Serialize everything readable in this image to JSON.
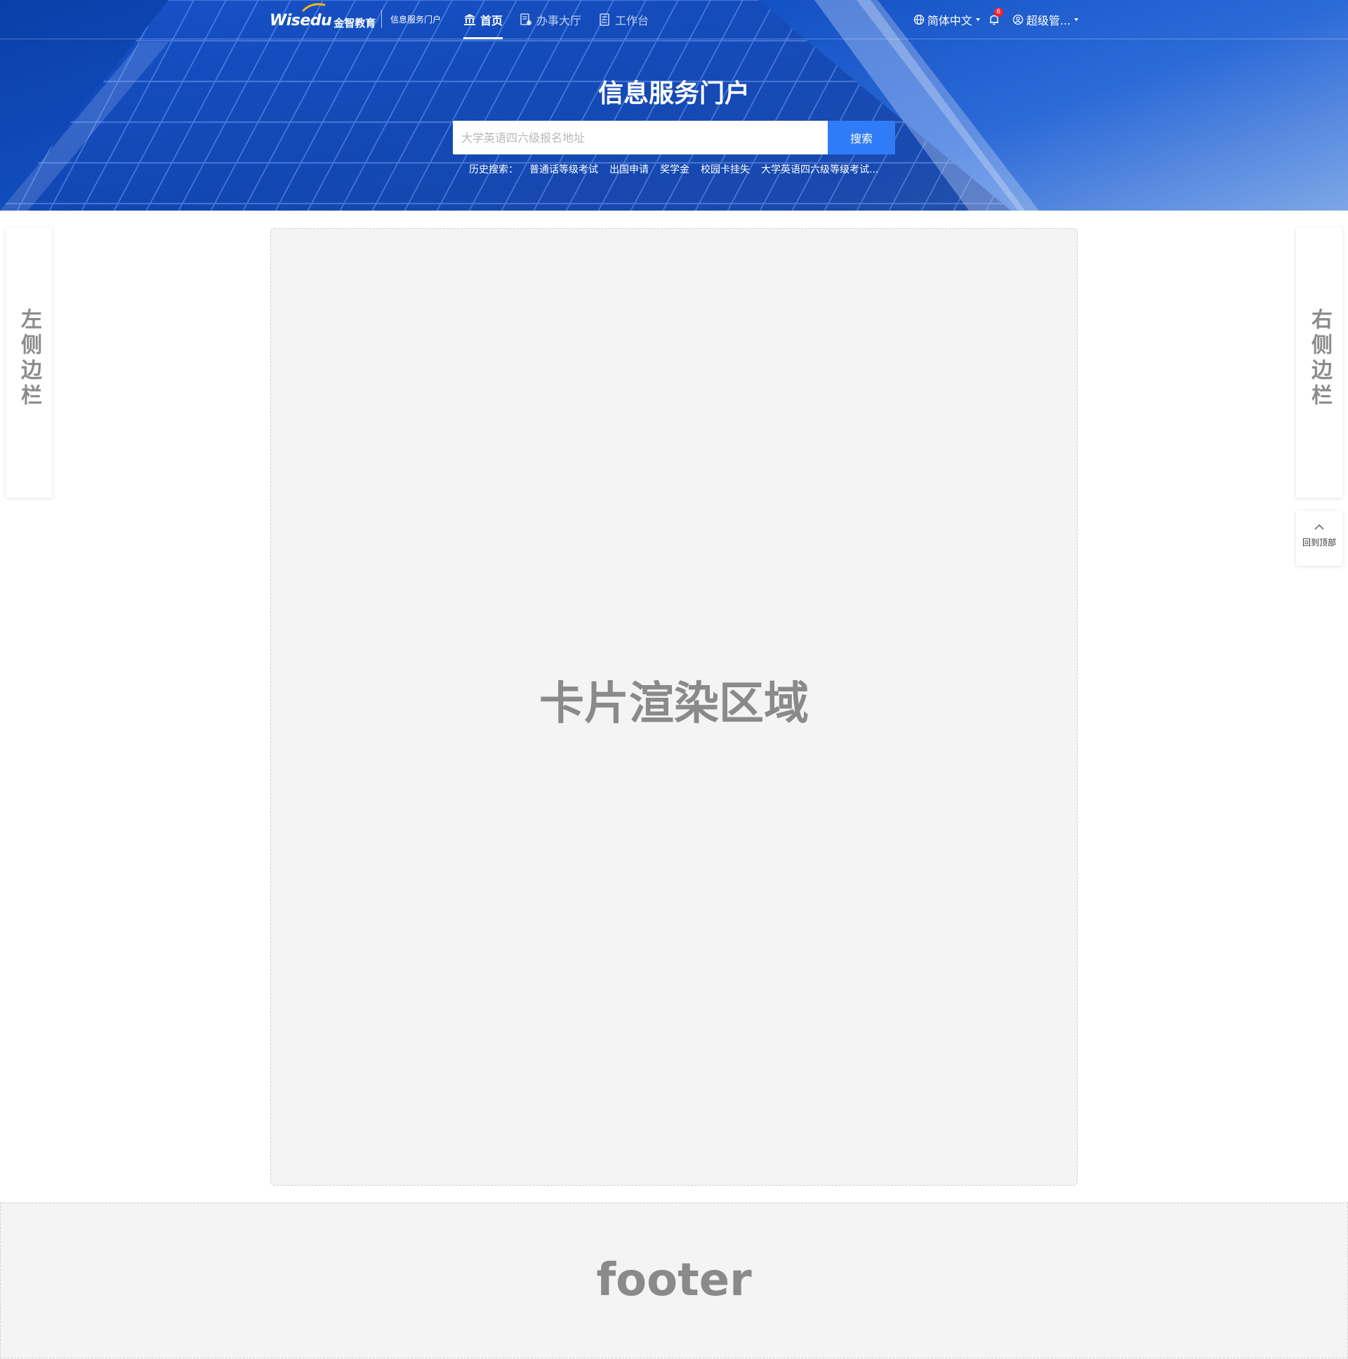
{
  "header": {
    "logo_text": "Wisedu",
    "logo_cn": "金智教育",
    "portal_name": "信息服务门户",
    "nav": [
      {
        "label": "首页",
        "icon": "bank-icon",
        "active": true
      },
      {
        "label": "办事大厅",
        "icon": "form-icon",
        "active": false
      },
      {
        "label": "工作台",
        "icon": "document-icon",
        "active": false
      }
    ],
    "language": "简体中文",
    "notification_count": "6",
    "user_name": "超级管..."
  },
  "hero": {
    "title": "信息服务门户",
    "search_placeholder": "大学英语四六级报名地址",
    "search_button": "搜索",
    "history_label": "历史搜索：",
    "history": [
      "普通话等级考试",
      "出国申请",
      "奖学金",
      "校园卡挂失",
      "大学英语四六级等级考试..."
    ]
  },
  "left_sidebar": {
    "label": "左侧边栏"
  },
  "right_sidebar": {
    "label": "右侧边栏"
  },
  "back_to_top": {
    "label": "回到顶部"
  },
  "main": {
    "placeholder": "卡片渲染区域"
  },
  "footer": {
    "label": "footer"
  },
  "colors": {
    "hero_blue": "#1451c4",
    "search_button": "#2f7cf6",
    "badge_red": "#f5222d",
    "placeholder_gray": "#8a8a8a"
  }
}
